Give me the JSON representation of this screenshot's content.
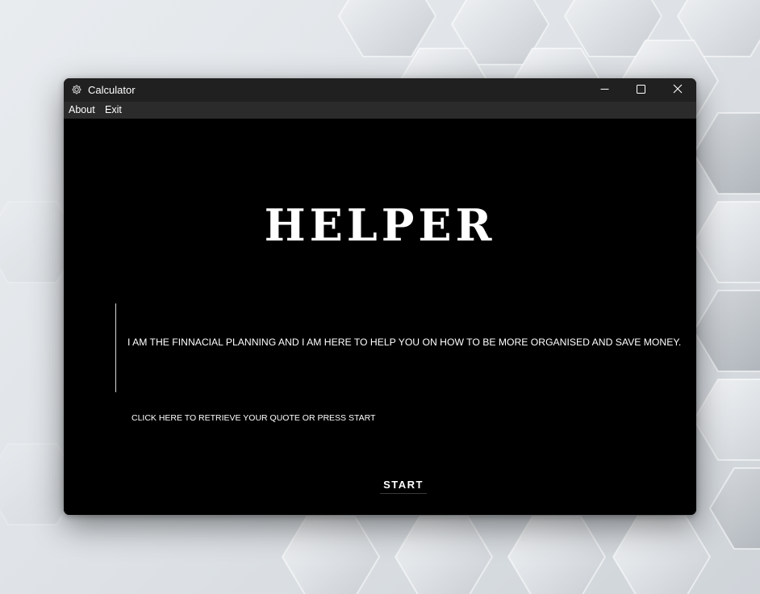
{
  "window": {
    "title": "Calculator",
    "app_icon": "gear-icon",
    "controls": {
      "minimize_icon": "minimize-icon",
      "maximize_icon": "maximize-icon",
      "close_icon": "close-icon"
    }
  },
  "menu": {
    "items": [
      {
        "label": "About"
      },
      {
        "label": "Exit"
      }
    ]
  },
  "main": {
    "heading": "HELPER",
    "intro": "I AM THE FINNACIAL PLANNING AND I AM HERE TO HELP YOU ON HOW TO BE MORE ORGANISED AND SAVE MONEY.",
    "retrieve_link": "CLICK HERE TO RETRIEVE YOUR QUOTE OR PRESS START",
    "start_button": "START"
  },
  "colors": {
    "titlebar": "#202020",
    "menubar": "#2b2b2b",
    "content_bg": "#000000",
    "text": "#ffffff"
  }
}
